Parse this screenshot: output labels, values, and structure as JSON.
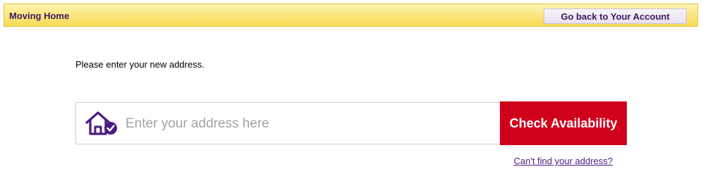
{
  "header": {
    "title": "Moving Home",
    "back_button_label": "Go back to Your Account"
  },
  "main": {
    "prompt": "Please enter your new address.",
    "address_input": {
      "placeholder": "Enter your address here",
      "value": ""
    },
    "check_button_label": "Check Availability",
    "cant_find_link": "Can't find your address?"
  },
  "colors": {
    "header_bg": "#fbe57c",
    "brand_purple": "#3b1b5e",
    "cta_red": "#d0021b",
    "link_purple": "#4b1c80"
  },
  "icons": {
    "address_icon": "house-check-icon"
  }
}
